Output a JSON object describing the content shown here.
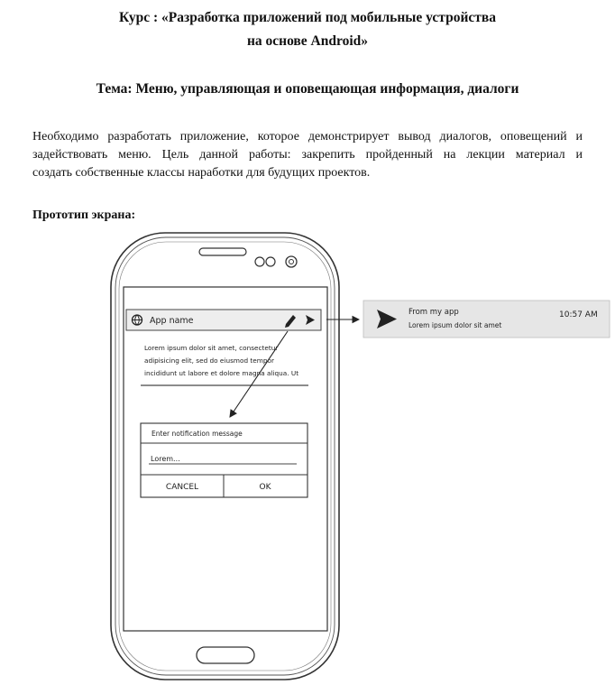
{
  "header": {
    "course_line1": "Курс : «Разработка приложений под мобильные устройства",
    "course_line2": "на основе Android»",
    "topic": "Тема: Меню, управляющая и оповещающая информация, диалоги"
  },
  "body": {
    "para_line1": "Необходимо разработать приложение, которое демонстрирует вывод диалогов, оповещений и",
    "para_line2": "задействовать меню. Цель данной работы: закрепить пройденный на лекции материал и",
    "para_line3": "создать собственные классы наработки для будущих проектов.",
    "prototype_label": "Прототип экрана:"
  },
  "mockup": {
    "app_bar_title": "App name",
    "content_line1": "Lorem ipsum dolor sit amet, consectetur",
    "content_line2": "adipisicing elit, sed do eiusmod tempor",
    "content_line3": "incididunt ut labore et dolore magna aliqua. Ut",
    "dialog_title": "Enter notification message",
    "dialog_input": "Lorem...",
    "cancel_label": "CANCEL",
    "ok_label": "OK",
    "notification_title": "From my app",
    "notification_text": "Lorem ipsum dolor sit amet",
    "notification_time": "10:57 AM",
    "icons": [
      "globe-icon",
      "pencil-icon",
      "send-icon",
      "notification-send-icon"
    ]
  }
}
